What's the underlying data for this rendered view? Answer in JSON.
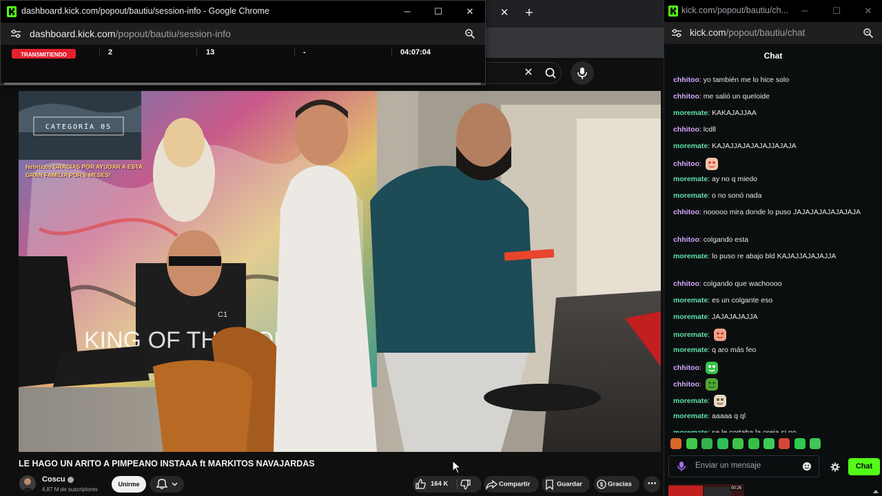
{
  "background_tab": {
    "tab_close": "✕",
    "new_tab": "+",
    "search_clear": "✕"
  },
  "video": {
    "title": "LE HAGO UN ARITO A PIMPEANO INSTAAA ft MARKITOS NAVAJARDAS",
    "overlay_category": "CATEGORÍA 0S",
    "overlay_banner_text": "ferbrizzio GRACIAS POR AYUDAR A ESTA GRAN FAMILIA POR 6 MESES!",
    "poster_text": "KING OF THE KON",
    "poster_code": "C1"
  },
  "channel": {
    "name": "Coscu",
    "subscribers": "4,87 M de suscriptores",
    "join_label": "Unirme"
  },
  "actions": {
    "likes": "164 K",
    "share_label": "Compartir",
    "save_label": "Guardar",
    "thanks_label": "Gracias",
    "more_label": "⋯"
  },
  "dashboard_window": {
    "title": "dashboard.kick.com/popout/bautiu/session-info - Google Chrome",
    "url_domain": "dashboard.kick.com",
    "url_path": "/popout/bautiu/session-info",
    "live_badge": "TRANSMITIENDO",
    "stats": [
      "2",
      "13",
      "-",
      "04:07:04"
    ],
    "controls": {
      "minimize": "─",
      "maximize": "☐",
      "close": "✕"
    }
  },
  "chat_window": {
    "title": "kick.com/popout/bautiu/ch...",
    "url_domain": "kick.com",
    "url_path": "/popout/bautiu/chat",
    "header": "Chat",
    "controls": {
      "minimize": "─",
      "maximize": "☐",
      "close": "✕"
    },
    "messages": [
      {
        "user": "chhitoo",
        "text": "yo también me lo hice solo"
      },
      {
        "user": "chhitoo",
        "text": "me salió un queloide"
      },
      {
        "user": "moremate",
        "text": "KAKAJAJJAA"
      },
      {
        "user": "chhitoo",
        "text": "lcdll"
      },
      {
        "user": "moremate",
        "text": "KAJAJJAJAJAJAJJAJAJA"
      },
      {
        "user": "chhitoo",
        "text": "",
        "emote": "face-emote"
      },
      {
        "user": "moremate",
        "text": "ay no q miedo"
      },
      {
        "user": "moremate",
        "text": "o no sonó nada"
      },
      {
        "user": "chhitoo",
        "text": "nooooo mira donde lo puso JAJAJAJAJAJAJAJA"
      },
      {
        "user": "chhitoo",
        "text": "colgando esta"
      },
      {
        "user": "moremate",
        "text": "lo puso re abajo bld KAJAJJAJAJAJJA"
      },
      {
        "user": "chhitoo",
        "text": "colgando que wachoooo"
      },
      {
        "user": "moremate",
        "text": "es un colgante eso"
      },
      {
        "user": "moremate",
        "text": "JAJAJAJAJJA"
      },
      {
        "user": "moremate",
        "text": "",
        "emote": "pointing-emote"
      },
      {
        "user": "moremate",
        "text": "q aro más feo"
      },
      {
        "user": "chhitoo",
        "text": "",
        "emote": "frog-eyes-emote"
      },
      {
        "user": "chhitoo",
        "text": "",
        "emote": "frog-emote"
      },
      {
        "user": "moremate",
        "text": "",
        "emote": "hand-emote"
      },
      {
        "user": "moremate",
        "text": "aaaaa q ql"
      },
      {
        "user": "moremate",
        "text": "se le cortaba la oreja si no"
      }
    ],
    "input_placeholder": "Enviar un mensaje",
    "send_label": "Chat",
    "thumb_label": "00:26"
  },
  "colors": {
    "kick_green": "#53fc18",
    "live_red": "#e5202f",
    "chhitoo": "#d7a7ff",
    "moremate": "#5ee0a8"
  }
}
